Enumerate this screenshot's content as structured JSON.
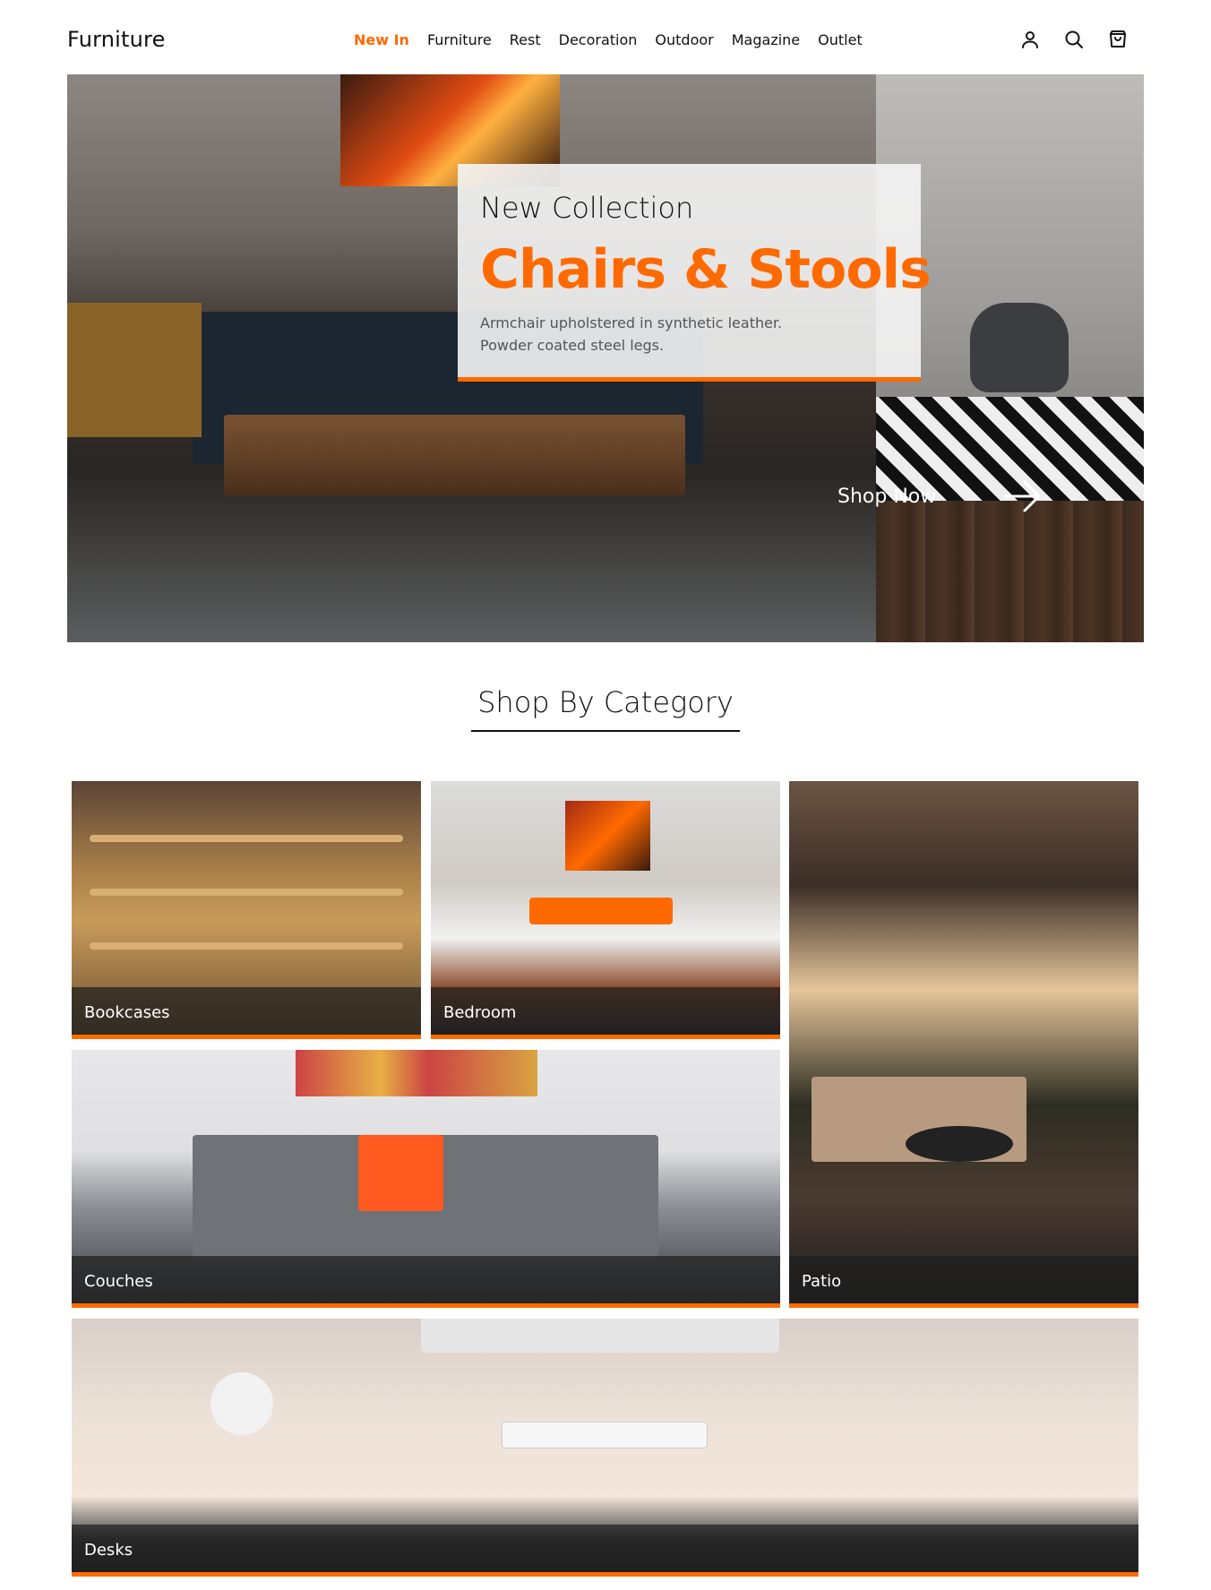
{
  "brand": {
    "name": "Furniture"
  },
  "nav": {
    "items": [
      {
        "label": "New In",
        "active": true
      },
      {
        "label": "Furniture",
        "active": false
      },
      {
        "label": "Rest",
        "active": false
      },
      {
        "label": "Decoration",
        "active": false
      },
      {
        "label": "Outdoor",
        "active": false
      },
      {
        "label": "Magazine",
        "active": false
      },
      {
        "label": "Outlet",
        "active": false
      }
    ]
  },
  "header_icons": [
    "user-icon",
    "search-icon",
    "cart-icon"
  ],
  "hero": {
    "kicker": "New Collection",
    "title": "Chairs & Stools",
    "description_line1": "Armchair upholstered in synthetic leather.",
    "description_line2": "Powder coated steel legs.",
    "cta_label": "Shop Now",
    "cta_icon": "arrow-right-icon"
  },
  "categories": {
    "title": "Shop By Category",
    "tiles": [
      {
        "label": "Bookcases"
      },
      {
        "label": "Bedroom"
      },
      {
        "label": "Patio"
      },
      {
        "label": "Couches"
      },
      {
        "label": "Desks"
      }
    ]
  },
  "colors": {
    "accent": "#ff6a00",
    "text": "#111111",
    "muted": "#555555"
  }
}
